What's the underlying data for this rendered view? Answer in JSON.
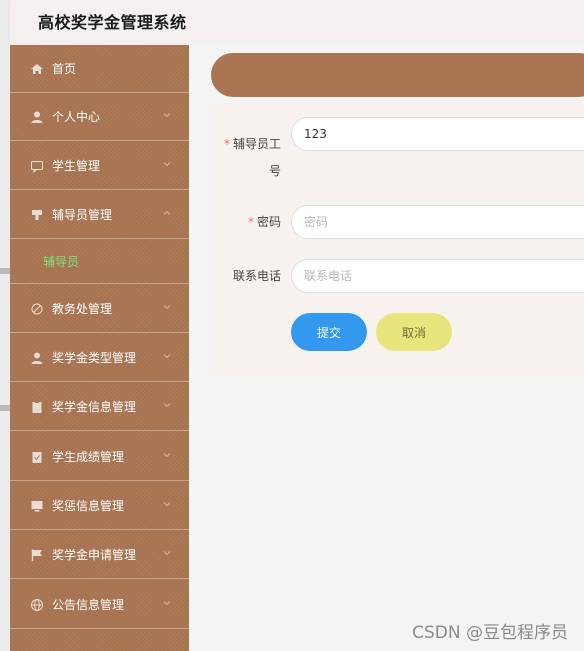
{
  "header": {
    "title": "高校奖学金管理系统"
  },
  "sidebar": {
    "items": [
      {
        "label": "首页",
        "icon": "home-icon"
      },
      {
        "label": "个人中心",
        "icon": "user-icon"
      },
      {
        "label": "学生管理",
        "icon": "chat-icon"
      },
      {
        "label": "辅导员管理",
        "icon": "flag-icon"
      },
      {
        "label": "教务处管理",
        "icon": "slash-icon"
      },
      {
        "label": "奖学金类型管理",
        "icon": "user-icon"
      },
      {
        "label": "奖学金信息管理",
        "icon": "clipboard-icon"
      },
      {
        "label": "学生成绩管理",
        "icon": "clipboard-icon"
      },
      {
        "label": "奖惩信息管理",
        "icon": "monitor-icon"
      },
      {
        "label": "奖学金申请管理",
        "icon": "flag-icon"
      },
      {
        "label": "公告信息管理",
        "icon": "globe-icon"
      }
    ],
    "submenu": {
      "label": "辅导员"
    }
  },
  "form": {
    "fields": {
      "id": {
        "label_line1": "辅导员工",
        "label_line2": "号",
        "value": "123"
      },
      "password": {
        "label": "密码",
        "placeholder": "密码"
      },
      "phone": {
        "label": "联系电话",
        "placeholder": "联系电话"
      }
    },
    "submit_label": "提交",
    "cancel_label": "取消"
  },
  "watermark": "CSDN @豆包程序员",
  "colors": {
    "sidebar": "#a97552",
    "submenu_active": "#7ee07e",
    "submit": "#3399ef",
    "cancel": "#e8e57c",
    "required": "#f56c6c"
  }
}
